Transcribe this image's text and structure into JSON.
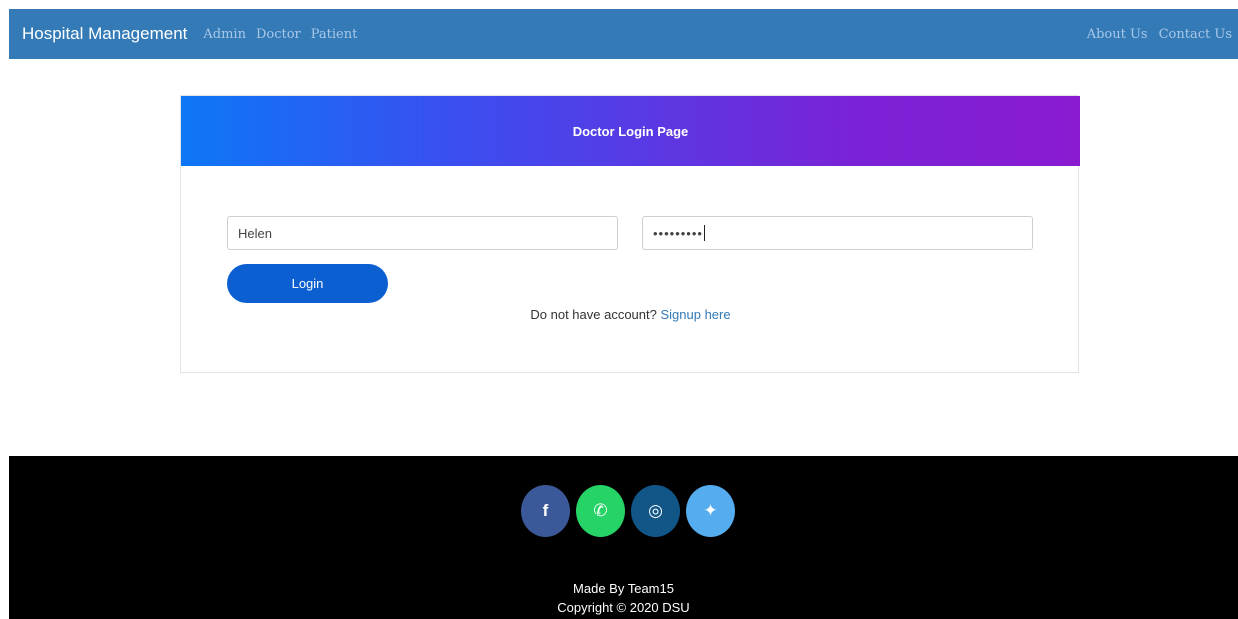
{
  "navbar": {
    "brand": "Hospital Management",
    "left_links": [
      "Admin",
      "Doctor",
      "Patient"
    ],
    "right_links": [
      "About Us",
      "Contact Us"
    ],
    "background": "#337ab7"
  },
  "card": {
    "title": "Doctor Login Page",
    "username_value": "Helen",
    "password_mask": "•••••••••",
    "login_label": "Login",
    "signup_prompt": "Do not have account?",
    "signup_link": "Signup here",
    "login_button_color": "#0b5fd0"
  },
  "footer": {
    "socials": [
      {
        "name": "facebook",
        "glyph": "f",
        "color": "#3b5998"
      },
      {
        "name": "whatsapp",
        "glyph": "✆",
        "color": "#25d366"
      },
      {
        "name": "instagram",
        "glyph": "◎",
        "color": "#125688"
      },
      {
        "name": "twitter",
        "glyph": "✦",
        "color": "#55acee"
      }
    ],
    "made_by": "Made By Team15",
    "copyright": "Copyright © 2020 DSU"
  }
}
